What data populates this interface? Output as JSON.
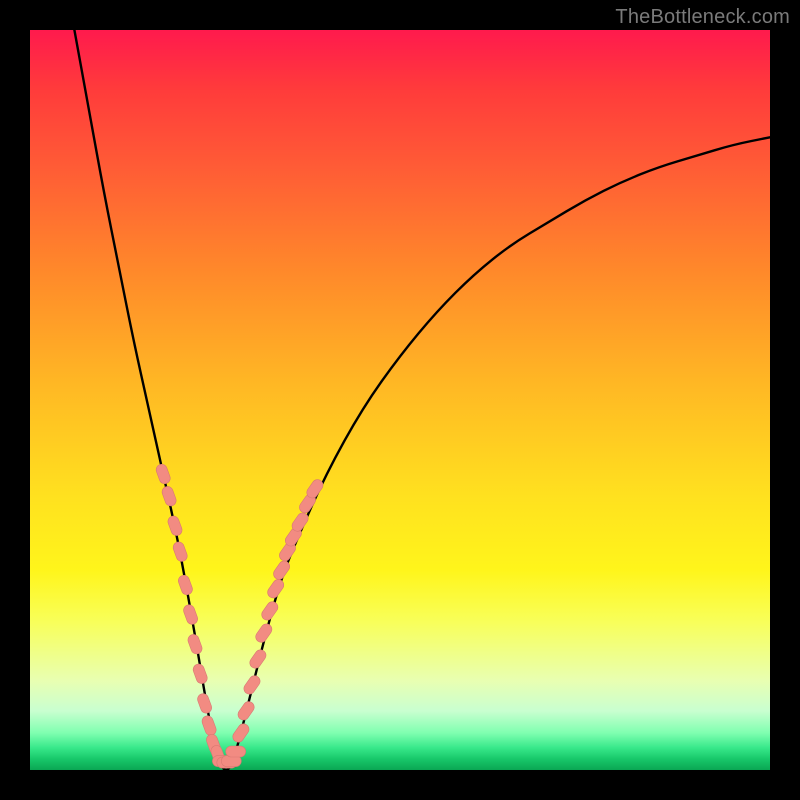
{
  "watermark": "TheBottleneck.com",
  "colors": {
    "frame": "#000000",
    "curve": "#000000",
    "marker_fill": "#f28b82",
    "marker_stroke": "#d97a72",
    "gradient_top": "#ff1a4d",
    "gradient_bottom": "#0aa653"
  },
  "chart_data": {
    "type": "line",
    "title": "",
    "xlabel": "",
    "ylabel": "",
    "xlim": [
      0,
      100
    ],
    "ylim": [
      0,
      100
    ],
    "grid": false,
    "legend": false,
    "description": "V-shaped bottleneck curve (y = percent bottleneck) over a vertical red→green gradient. Minimum lies near x≈24-27. Pink pill-shaped markers cluster on both arms near the bottom of the V.",
    "series": [
      {
        "name": "bottleneck-curve",
        "x": [
          6,
          8,
          10,
          12,
          14,
          16,
          18,
          20,
          22,
          24,
          25,
          26,
          27,
          28,
          30,
          32,
          34,
          36,
          40,
          45,
          50,
          55,
          60,
          65,
          70,
          75,
          80,
          85,
          90,
          95,
          100
        ],
        "y": [
          100,
          89,
          78,
          68,
          58,
          49,
          40,
          31,
          20,
          8,
          3,
          0,
          0,
          3,
          11,
          19,
          26,
          31,
          40,
          49,
          56,
          62,
          67,
          71,
          74,
          77,
          79.5,
          81.5,
          83,
          84.5,
          85.5
        ]
      }
    ],
    "markers": [
      {
        "x": 18.0,
        "y": 40.0,
        "arm": "left"
      },
      {
        "x": 18.8,
        "y": 37.0,
        "arm": "left"
      },
      {
        "x": 19.6,
        "y": 33.0,
        "arm": "left"
      },
      {
        "x": 20.3,
        "y": 29.5,
        "arm": "left"
      },
      {
        "x": 21.0,
        "y": 25.0,
        "arm": "left"
      },
      {
        "x": 21.7,
        "y": 21.0,
        "arm": "left"
      },
      {
        "x": 22.3,
        "y": 17.0,
        "arm": "left"
      },
      {
        "x": 23.0,
        "y": 13.0,
        "arm": "left"
      },
      {
        "x": 23.6,
        "y": 9.0,
        "arm": "left"
      },
      {
        "x": 24.2,
        "y": 6.0,
        "arm": "left"
      },
      {
        "x": 24.8,
        "y": 3.5,
        "arm": "left"
      },
      {
        "x": 25.4,
        "y": 2.0,
        "arm": "left"
      },
      {
        "x": 26.0,
        "y": 1.2,
        "arm": "bottom"
      },
      {
        "x": 26.6,
        "y": 1.0,
        "arm": "bottom"
      },
      {
        "x": 27.2,
        "y": 1.2,
        "arm": "bottom"
      },
      {
        "x": 27.8,
        "y": 2.5,
        "arm": "bottom"
      },
      {
        "x": 28.5,
        "y": 5.0,
        "arm": "right"
      },
      {
        "x": 29.2,
        "y": 8.0,
        "arm": "right"
      },
      {
        "x": 30.0,
        "y": 11.5,
        "arm": "right"
      },
      {
        "x": 30.8,
        "y": 15.0,
        "arm": "right"
      },
      {
        "x": 31.6,
        "y": 18.5,
        "arm": "right"
      },
      {
        "x": 32.4,
        "y": 21.5,
        "arm": "right"
      },
      {
        "x": 33.2,
        "y": 24.5,
        "arm": "right"
      },
      {
        "x": 34.0,
        "y": 27.0,
        "arm": "right"
      },
      {
        "x": 34.8,
        "y": 29.5,
        "arm": "right"
      },
      {
        "x": 35.6,
        "y": 31.5,
        "arm": "right"
      },
      {
        "x": 36.5,
        "y": 33.5,
        "arm": "right"
      },
      {
        "x": 37.5,
        "y": 36.0,
        "arm": "right"
      },
      {
        "x": 38.5,
        "y": 38.0,
        "arm": "right"
      }
    ]
  }
}
